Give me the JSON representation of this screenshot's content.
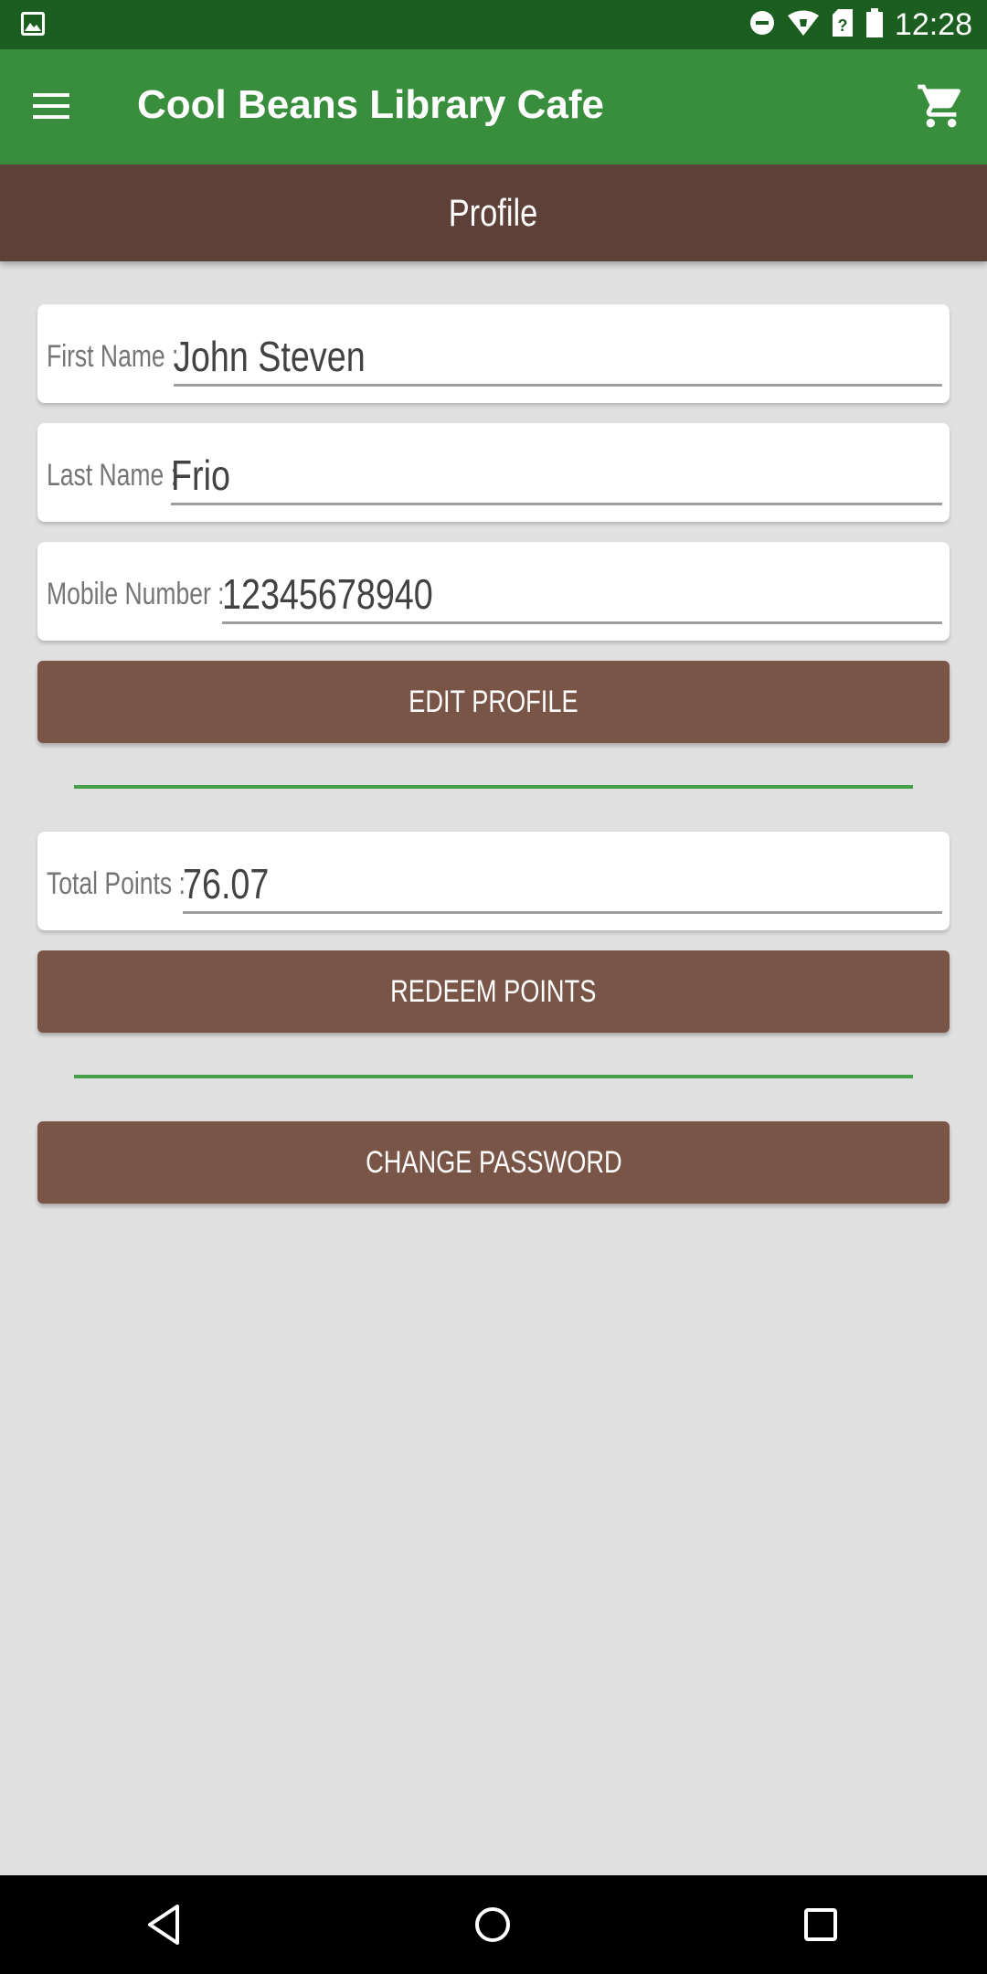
{
  "status_bar": {
    "time": "12:28",
    "icons": [
      "image-notification-icon",
      "do-not-disturb-icon",
      "wifi-icon",
      "sim-icon",
      "battery-icon"
    ]
  },
  "app_bar": {
    "title": "Cool Beans Library Cafe",
    "icons": [
      "menu-icon",
      "cart-icon"
    ]
  },
  "section": {
    "title": "Profile"
  },
  "profile": {
    "first_name": {
      "label": "First Name :",
      "value": "John Steven"
    },
    "last_name": {
      "label": "Last Name :",
      "value": "Frio"
    },
    "mobile": {
      "label": "Mobile Number :",
      "value": "12345678940"
    }
  },
  "buttons": {
    "edit_profile": "EDIT PROFILE",
    "redeem_points": "REDEEM POINTS",
    "change_password": "CHANGE PASSWORD"
  },
  "points": {
    "label": "Total Points :",
    "value": "76.07"
  },
  "nav_bar": {
    "icons": [
      "back-icon",
      "home-icon",
      "recents-icon"
    ]
  },
  "colors": {
    "status_bar": "#1b5e20",
    "app_bar": "#388e3c",
    "section_header": "#5d4037",
    "button": "#795548",
    "divider": "#43a047",
    "background": "#e0e0e0"
  }
}
